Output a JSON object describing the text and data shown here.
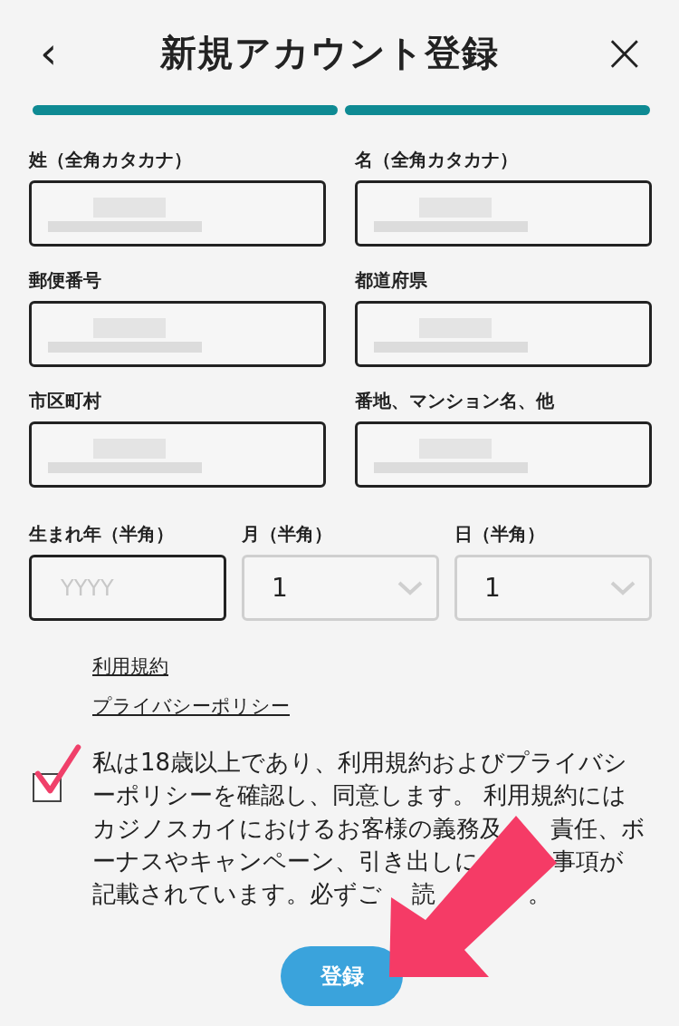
{
  "header": {
    "back": "‹",
    "title": "新規アカウント登録",
    "close": "×"
  },
  "steps": [
    {
      "completed": true
    },
    {
      "completed": true
    }
  ],
  "address_fields": [
    {
      "label": "姓（全角カタカナ）",
      "redacted": true
    },
    {
      "label": "名（全角カタカナ）",
      "redacted": true
    },
    {
      "label": "郵便番号",
      "redacted": true
    },
    {
      "label": "都道府県",
      "redacted": true
    },
    {
      "label": "市区町村",
      "redacted": true
    },
    {
      "label": "番地、マンション名、他",
      "redacted": true
    }
  ],
  "birth_fields": [
    {
      "kind": "input",
      "label": "生まれ年（半角）",
      "placeholder": "YYYY"
    },
    {
      "kind": "select",
      "label": "月（半角）",
      "value": "1"
    },
    {
      "kind": "select",
      "label": "日（半角）",
      "value": "1"
    }
  ],
  "links": [
    "利用規約",
    "プライバシーポリシー"
  ],
  "consent": {
    "checked": true,
    "lines": [
      [
        "私は18歳以上であり、利用規約およびプライバシ"
      ],
      [
        "ーポリシーを確認し、同意します。 利用規約には"
      ],
      [
        "カジノスカイにおけるお客様の義務及",
        "責任、ボ"
      ],
      [
        "ーナスやキャンペーン、引き出しに",
        "事項が"
      ],
      [
        "記載されています。必ずご",
        "読",
        "。"
      ]
    ]
  },
  "submit": "登録"
}
